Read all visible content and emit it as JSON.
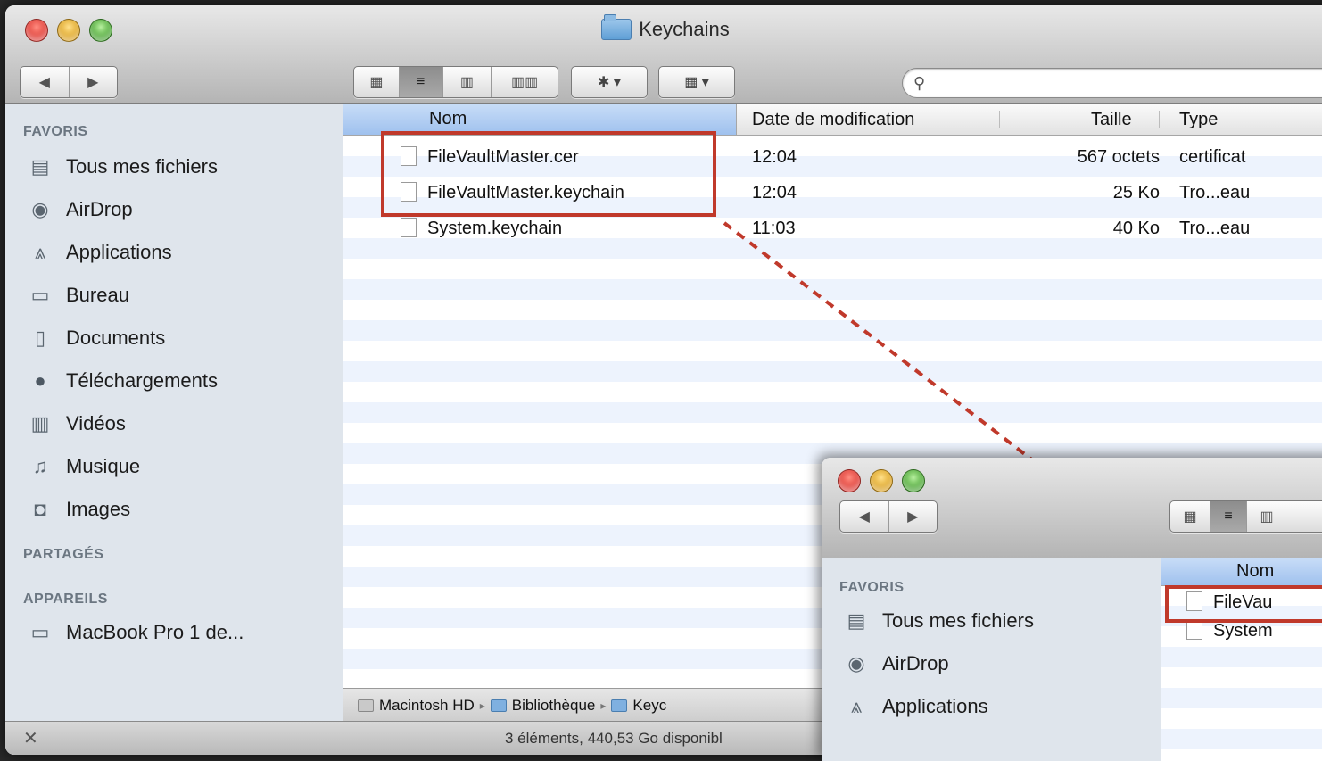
{
  "main_window": {
    "title": "Keychains",
    "nav_back": "◀",
    "nav_forward": "▶",
    "view_icon": "▦",
    "view_list": "≡",
    "view_columns": "▥",
    "view_coverflow": "▥▥",
    "action_button": "✱ ▾",
    "arrange_button": "▦ ▾",
    "search_placeholder": "",
    "sidebar": {
      "favorites_header": "FAVORIS",
      "favorites": [
        {
          "label": "Tous mes fichiers",
          "icon": "all-files-icon"
        },
        {
          "label": "AirDrop",
          "icon": "airdrop-icon"
        },
        {
          "label": "Applications",
          "icon": "applications-icon"
        },
        {
          "label": "Bureau",
          "icon": "desktop-icon"
        },
        {
          "label": "Documents",
          "icon": "documents-icon"
        },
        {
          "label": "Téléchargements",
          "icon": "downloads-icon"
        },
        {
          "label": "Vidéos",
          "icon": "movies-icon"
        },
        {
          "label": "Musique",
          "icon": "music-icon"
        },
        {
          "label": "Images",
          "icon": "pictures-icon"
        }
      ],
      "shared_header": "PARTAGÉS",
      "devices_header": "APPAREILS",
      "devices": [
        {
          "label": "MacBook Pro 1 de...",
          "icon": "laptop-icon"
        }
      ]
    },
    "columns": {
      "name": "Nom",
      "date": "Date de modification",
      "size": "Taille",
      "type": "Type"
    },
    "files": [
      {
        "name": "FileVaultMaster.cer",
        "date": "12:04",
        "size": "567 octets",
        "type": "certificat"
      },
      {
        "name": "FileVaultMaster.keychain",
        "date": "12:04",
        "size": "25 Ko",
        "type": "Tro...eau"
      },
      {
        "name": "System.keychain",
        "date": "11:03",
        "size": "40 Ko",
        "type": "Tro...eau"
      }
    ],
    "path": {
      "disk": "Macintosh HD",
      "sep1": "▸",
      "library": "Bibliothèque",
      "sep2": "▸",
      "current": "Keyc"
    },
    "status": "3 éléments, 440,53 Go disponibl",
    "status_icon": "✕"
  },
  "second_window": {
    "favorites_header": "FAVORIS",
    "favorites": [
      {
        "label": "Tous mes fichiers",
        "icon": "all-files-icon"
      },
      {
        "label": "AirDrop",
        "icon": "airdrop-icon"
      },
      {
        "label": "Applications",
        "icon": "applications-icon"
      }
    ],
    "name_column": "Nom",
    "files": [
      "FileVau",
      "System"
    ]
  },
  "colors": {
    "highlight_box": "#c0392b",
    "sidebar_bg": "#dfe5ec",
    "stripe": "#edf3fd"
  }
}
